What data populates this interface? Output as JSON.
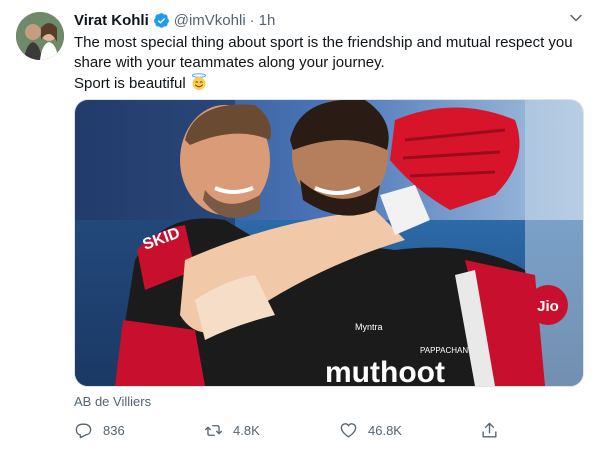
{
  "tweet": {
    "author_name": "Virat Kohli",
    "handle": "@imVkohli",
    "separator": "·",
    "time": "1h",
    "text_line1": "The most special thing about sport is the friendship and mutual respect you share with your teammates along your journey.",
    "text_line2": "Sport is beautiful",
    "emoji": "smiling-face-with-halo",
    "tagged_user": "AB de Villiers",
    "jersey_sponsor": "muthoot",
    "jersey_sponsor_sub": "PAPPACHAN",
    "jersey_badge": "Jio",
    "jersey_small_brand": "Myntra"
  },
  "actions": {
    "reply_count": "836",
    "retweet_count": "4.8K",
    "like_count": "46.8K"
  },
  "colors": {
    "verified": "#1d9bf0",
    "secondary_text": "#536471",
    "jersey_red": "#c8102e",
    "jersey_black": "#1b1b1b"
  }
}
